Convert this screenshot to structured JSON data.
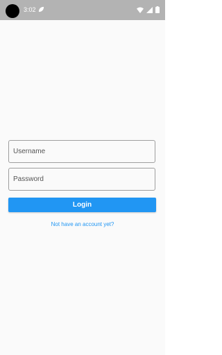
{
  "status_bar": {
    "time": "3:02",
    "icons": [
      "notification-leaf-icon",
      "wifi-icon",
      "signal-icon",
      "battery-icon"
    ]
  },
  "form": {
    "username_placeholder": "Username",
    "password_placeholder": "Password",
    "login_label": "Login",
    "signup_link": "Not have an account yet?"
  },
  "colors": {
    "accent": "#2196f3",
    "status_bar": "#b3b3b3",
    "background": "#fafafa"
  }
}
